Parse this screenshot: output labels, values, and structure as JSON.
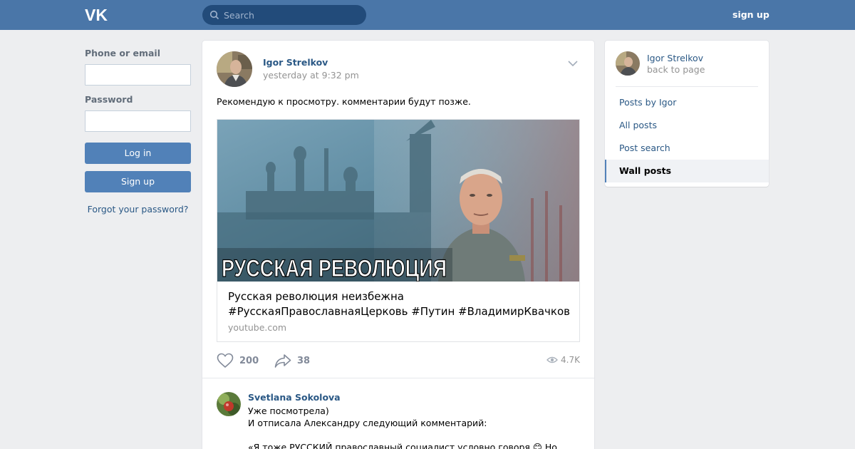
{
  "header": {
    "logo_icon": "vk-logo-icon",
    "search_placeholder": "Search",
    "signup_label": "sign up"
  },
  "login": {
    "phone_label": "Phone or email",
    "phone_value": "",
    "password_label": "Password",
    "password_value": "",
    "login_button": "Log in",
    "signup_button": "Sign up",
    "forgot_link": "Forgot your password?"
  },
  "post": {
    "author": "Igor Strelkov",
    "time": "yesterday at 9:32 pm",
    "text": "Рекомендую к просмотру. комментарии будут позже.",
    "media": {
      "banner_text": "РУССКАЯ РЕВОЛЮЦИЯ",
      "title": "Русская революция неизбежна #РусскаяПравославнаяЦерковь #Путин #ВладимирКвачков",
      "source": "youtube.com"
    },
    "likes": "200",
    "shares": "38",
    "views": "4.7K"
  },
  "comment": {
    "author": "Svetlana Sokolova",
    "text": "Уже посмотрела)\nИ отписала Александру следующий комментарий:\n\n«Я тоже РУССКИЙ православный социалист условно говоря 😊 Но насчет"
  },
  "sidebar": {
    "name": "Igor Strelkov",
    "back": "back to page",
    "items": [
      {
        "label": "Posts by Igor"
      },
      {
        "label": "All posts"
      },
      {
        "label": "Post search"
      },
      {
        "label": "Wall posts"
      }
    ]
  },
  "colors": {
    "header_bg": "#4a76a8",
    "link": "#2a5885",
    "button": "#5181b8",
    "page_bg": "#edeef0"
  }
}
